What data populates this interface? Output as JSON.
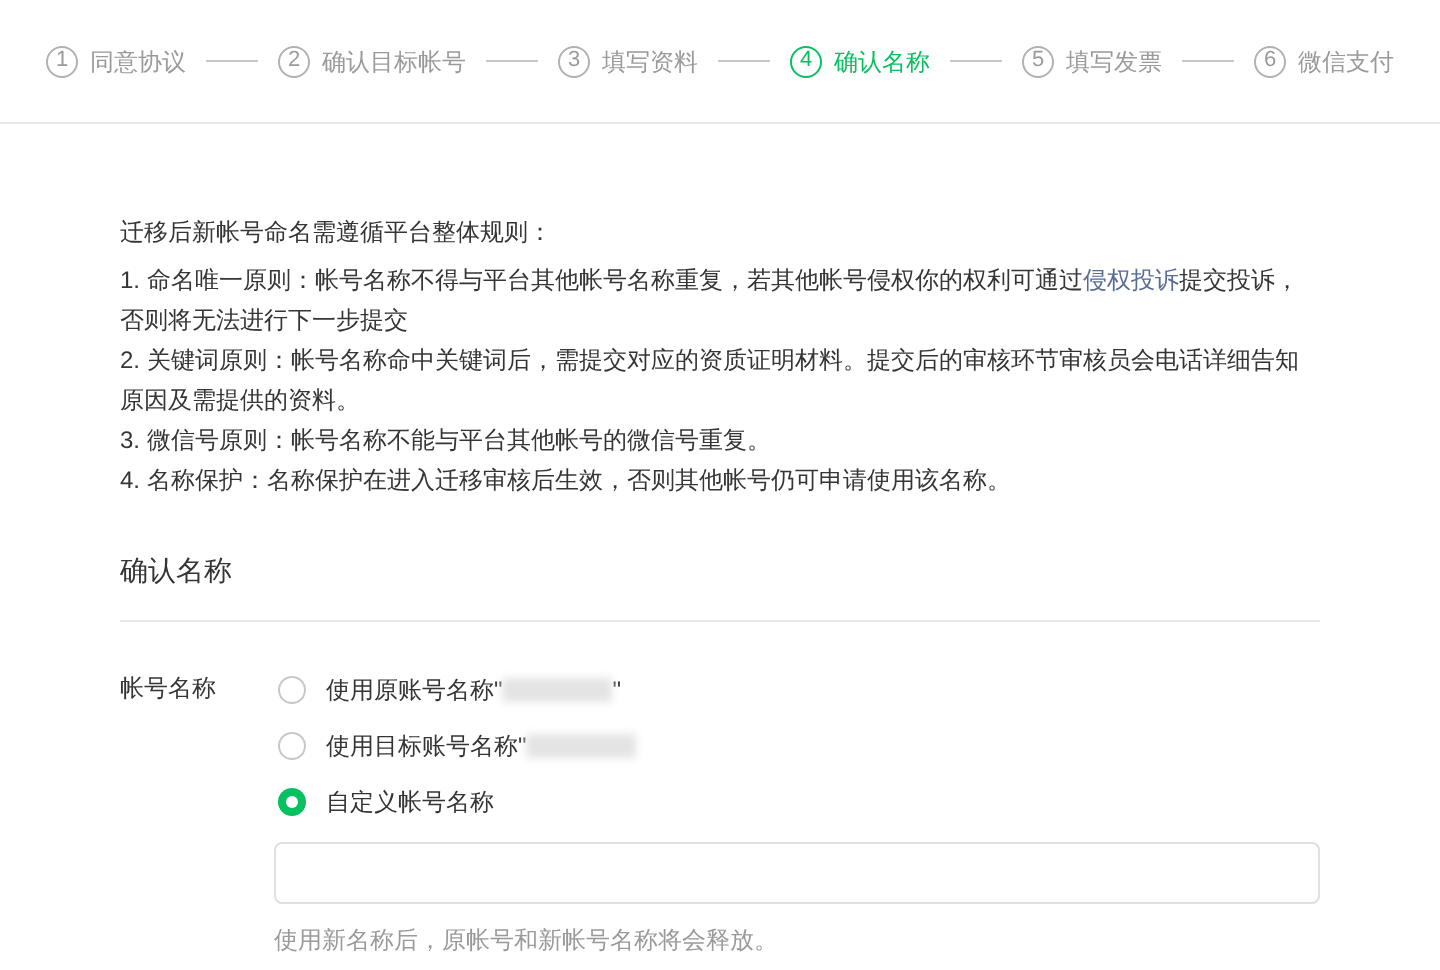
{
  "steps": [
    {
      "number": "1",
      "label": "同意协议",
      "selected": false
    },
    {
      "number": "2",
      "label": "确认目标帐号",
      "selected": false
    },
    {
      "number": "3",
      "label": "填写资料",
      "selected": false
    },
    {
      "number": "4",
      "label": "确认名称",
      "selected": true
    },
    {
      "number": "5",
      "label": "填写发票",
      "selected": false
    },
    {
      "number": "6",
      "label": "微信支付",
      "selected": false
    }
  ],
  "rules": {
    "heading": "迁移后新帐号命名需遵循平台整体规则：",
    "items": [
      {
        "text": "1. 命名唯一原则：帐号名称不得与平台其他帐号名称重复，若其他帐号侵权你的权利可通过",
        "link": "侵权投诉",
        "after": "提交投诉，否则将无法进行下一步提交"
      },
      {
        "text": "2. 关键词原则：帐号名称命中关键词后，需提交对应的资质证明材料。提交后的审核环节审核员会电话详细告知原因及需提供的资料。"
      },
      {
        "text": "3. 微信号原则：帐号名称不能与平台其他帐号的微信号重复。"
      },
      {
        "text": "4. 名称保护：名称保护在进入迁移审核后生效，否则其他帐号仍可申请使用该名称。"
      }
    ]
  },
  "section_title": "确认名称",
  "form": {
    "label": "帐号名称",
    "options": [
      {
        "label": "使用原账号名称\"",
        "suffix": "\"",
        "redacted": true,
        "selected": false
      },
      {
        "label": "使用目标账号名称\"",
        "redacted": true,
        "selected": false
      },
      {
        "label": "自定义帐号名称",
        "redacted": false,
        "selected": true
      }
    ],
    "hint": "使用新名称后，原帐号和新帐号名称将会释放。"
  }
}
